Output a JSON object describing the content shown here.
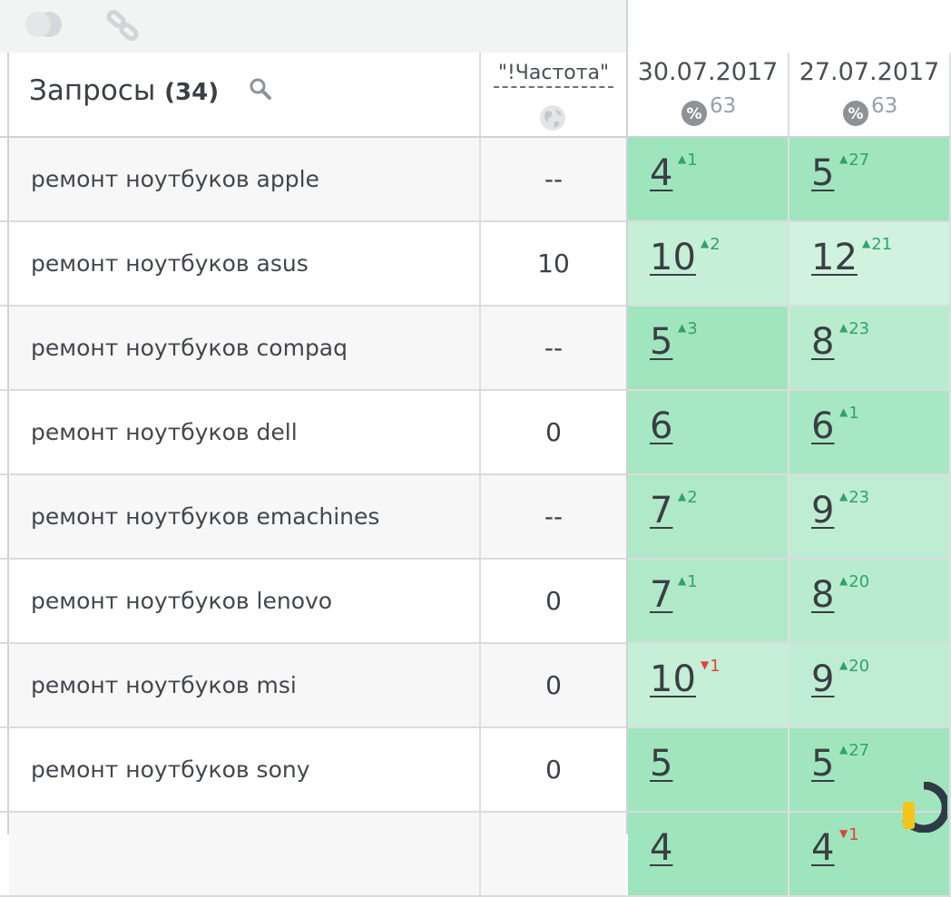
{
  "toolbar": {
    "toggle_icon": "toggle-icon",
    "link_icon": "link-icon"
  },
  "header": {
    "queries_title": "Запросы",
    "queries_count": "(34)",
    "frequency_label": "\"!Частота\"",
    "dates": [
      {
        "date": "30.07.2017",
        "percent": "63"
      },
      {
        "date": "27.07.2017",
        "percent": "63"
      }
    ]
  },
  "colors": {
    "green_strong": "#8fe0b3",
    "green_mid": "#a8e8c3",
    "green_light": "#c8f0d8",
    "green_pale": "#e2f7ea",
    "delta_up": "#2fa36b",
    "delta_down": "#e0433a"
  },
  "rows": [
    {
      "query": "ремонт ноутбуков apple",
      "freq": "--",
      "positions": [
        {
          "value": "4",
          "delta": "1",
          "dir": "up",
          "shade": 0.82
        },
        {
          "value": "5",
          "delta": "27",
          "dir": "up",
          "shade": 0.78
        }
      ]
    },
    {
      "query": "ремонт ноутбуков asus",
      "freq": "10",
      "positions": [
        {
          "value": "10",
          "delta": "2",
          "dir": "up",
          "shade": 0.35
        },
        {
          "value": "12",
          "delta": "21",
          "dir": "up",
          "shade": 0.22
        }
      ]
    },
    {
      "query": "ремонт ноутбуков compaq",
      "freq": "--",
      "positions": [
        {
          "value": "5",
          "delta": "3",
          "dir": "up",
          "shade": 0.78
        },
        {
          "value": "8",
          "delta": "23",
          "dir": "up",
          "shade": 0.5
        }
      ]
    },
    {
      "query": "ремонт ноутбуков dell",
      "freq": "0",
      "positions": [
        {
          "value": "6",
          "delta": "",
          "dir": "",
          "shade": 0.7
        },
        {
          "value": "6",
          "delta": "1",
          "dir": "up",
          "shade": 0.7
        }
      ]
    },
    {
      "query": "ремонт ноутбуков emachines",
      "freq": "--",
      "positions": [
        {
          "value": "7",
          "delta": "2",
          "dir": "up",
          "shade": 0.62
        },
        {
          "value": "9",
          "delta": "23",
          "dir": "up",
          "shade": 0.42
        }
      ]
    },
    {
      "query": "ремонт ноутбуков lenovo",
      "freq": "0",
      "positions": [
        {
          "value": "7",
          "delta": "1",
          "dir": "up",
          "shade": 0.62
        },
        {
          "value": "8",
          "delta": "20",
          "dir": "up",
          "shade": 0.5
        }
      ]
    },
    {
      "query": "ремонт ноутбуков msi",
      "freq": "0",
      "positions": [
        {
          "value": "10",
          "delta": "1",
          "dir": "down",
          "shade": 0.35
        },
        {
          "value": "9",
          "delta": "20",
          "dir": "up",
          "shade": 0.42
        }
      ]
    },
    {
      "query": "ремонт ноутбуков sony",
      "freq": "0",
      "positions": [
        {
          "value": "5",
          "delta": "",
          "dir": "",
          "shade": 0.78
        },
        {
          "value": "5",
          "delta": "27",
          "dir": "up",
          "shade": 0.78
        }
      ]
    },
    {
      "query": "",
      "freq": "",
      "positions": [
        {
          "value": "4",
          "delta": "",
          "dir": "",
          "shade": 0.82
        },
        {
          "value": "4",
          "delta": "1",
          "dir": "down",
          "shade": 0.82
        }
      ]
    }
  ],
  "brand_icon": "brand-logo"
}
